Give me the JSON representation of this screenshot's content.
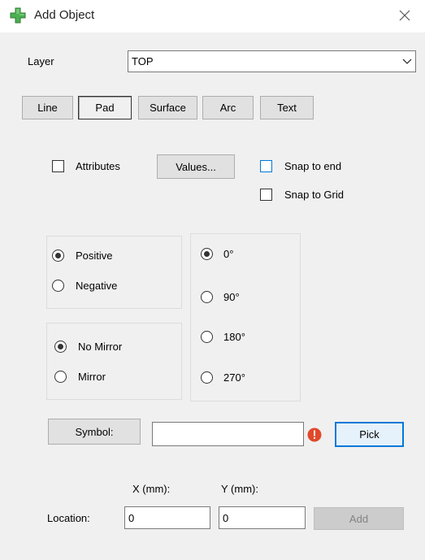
{
  "window": {
    "title": "Add Object",
    "close_icon": "close-icon",
    "title_icon": "green-plus-icon",
    "accent_color": "#4caf50"
  },
  "layer": {
    "label": "Layer",
    "value": "TOP"
  },
  "tabs": [
    {
      "label": "Line",
      "pressed": false
    },
    {
      "label": "Pad",
      "pressed": true
    },
    {
      "label": "Surface",
      "pressed": false
    },
    {
      "label": "Arc",
      "pressed": false
    },
    {
      "label": "Text",
      "pressed": false
    }
  ],
  "attributes": {
    "label": "Attributes",
    "checked": false,
    "values_button": "Values..."
  },
  "snap": {
    "to_end": "Snap to end",
    "to_grid": "Snap to Grid"
  },
  "polarity": {
    "positive": "Positive",
    "negative": "Negative",
    "selected": "positive"
  },
  "mirror": {
    "no_mirror": "No Mirror",
    "mirror": "Mirror",
    "selected": "no_mirror"
  },
  "rotation": {
    "options": [
      "0°",
      "90°",
      "180°",
      "270°"
    ],
    "selected": 0
  },
  "symbol": {
    "button": "Symbol:",
    "value": "",
    "error_icon": "error-icon",
    "error_color": "#e04a2a",
    "pick_button": "Pick"
  },
  "location": {
    "label": "Location:",
    "x_header": "X (mm):",
    "y_header": "Y (mm):",
    "x_value": "0",
    "y_value": "0",
    "add_button": "Add"
  }
}
